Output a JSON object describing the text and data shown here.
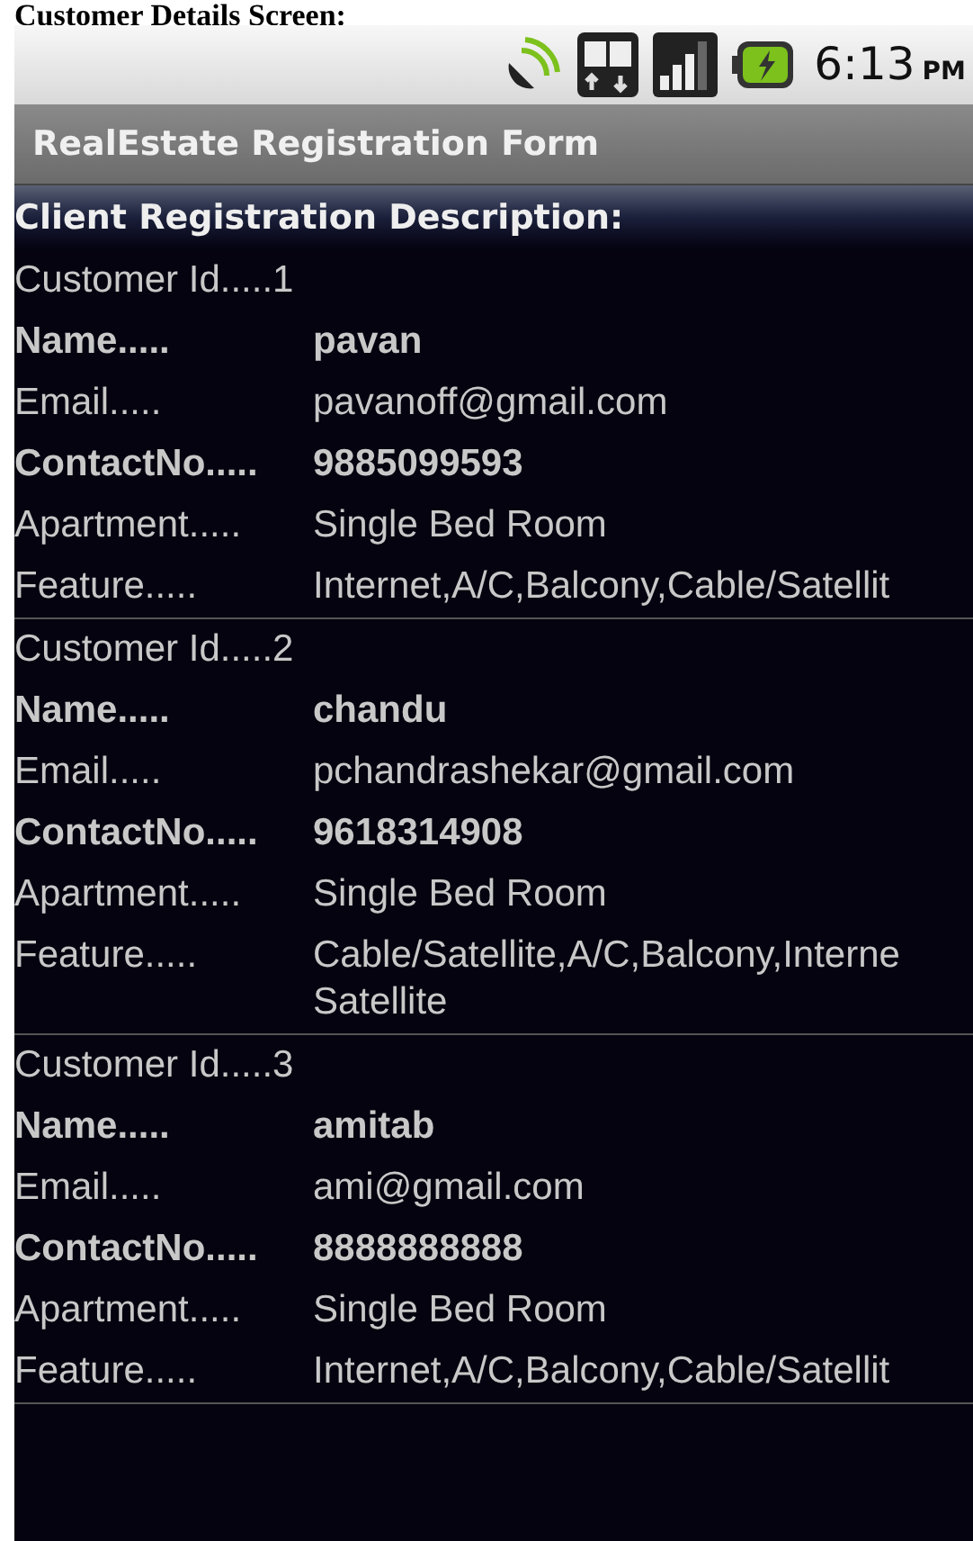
{
  "caption": "Customer Details Screen:",
  "status_bar": {
    "time": "6:13",
    "meridiem": "PM"
  },
  "title_bar": {
    "title": "RealEstate Registration Form"
  },
  "heading": "Client Registration Description:",
  "customers": [
    {
      "fields": [
        {
          "kind": "inline",
          "label": "Customer Id.....",
          "value": "1",
          "bold": false
        },
        {
          "kind": "column",
          "label": "Name.....",
          "value": "pavan",
          "bold": true
        },
        {
          "kind": "column",
          "label": "Email.....",
          "value": "pavanoff@gmail.com",
          "bold": false
        },
        {
          "kind": "column",
          "label": "ContactNo.....",
          "value": "9885099593",
          "bold": true
        },
        {
          "kind": "column",
          "label": "Apartment.....",
          "value": "Single Bed Room",
          "bold": false
        },
        {
          "kind": "column",
          "label": "Feature.....",
          "value": "Internet,A/C,Balcony,Cable/Satellit",
          "bold": false
        }
      ]
    },
    {
      "fields": [
        {
          "kind": "inline",
          "label": "Customer Id.....",
          "value": "2",
          "bold": false
        },
        {
          "kind": "column",
          "label": "Name.....",
          "value": "chandu",
          "bold": true
        },
        {
          "kind": "column",
          "label": "Email.....",
          "value": "pchandrashekar@gmail.com",
          "bold": false
        },
        {
          "kind": "column",
          "label": "ContactNo.....",
          "value": "9618314908",
          "bold": true
        },
        {
          "kind": "column",
          "label": "Apartment.....",
          "value": "Single Bed Room",
          "bold": false
        },
        {
          "kind": "column",
          "label": "Feature.....",
          "value": "Cable/Satellite,A/C,Balcony,Interne\nSatellite",
          "bold": false
        }
      ]
    },
    {
      "fields": [
        {
          "kind": "inline",
          "label": "Customer Id.....",
          "value": "3",
          "bold": false
        },
        {
          "kind": "column",
          "label": "Name.....",
          "value": "amitab",
          "bold": true
        },
        {
          "kind": "column",
          "label": "Email.....",
          "value": "ami@gmail.com",
          "bold": false
        },
        {
          "kind": "column",
          "label": "ContactNo.....",
          "value": "8888888888",
          "bold": true
        },
        {
          "kind": "column",
          "label": "Apartment.....",
          "value": "Single Bed Room",
          "bold": false
        },
        {
          "kind": "column",
          "label": "Feature.....",
          "value": "Internet,A/C,Balcony,Cable/Satellit",
          "bold": false
        }
      ]
    }
  ]
}
